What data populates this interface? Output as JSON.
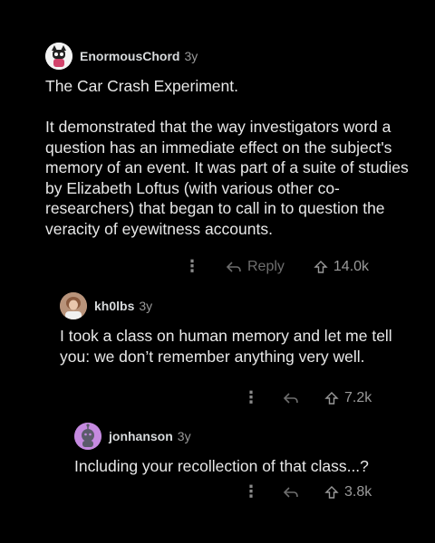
{
  "comments": [
    {
      "username": "EnormousChord",
      "age": "3y",
      "avatar_icon": "cat-avatar-icon",
      "avatar_color": "#ffffff",
      "text": "The Car Crash Experiment.\n\nIt demonstrated that the way investigators word a question has an immediate effect on the subject's memory of an event. It was part of a suite of studies by Elizabeth Loftus (with various other co-researchers) that began to call in to question the veracity of eyewitness accounts.",
      "reply_label": "Reply",
      "score": "14.0k"
    },
    {
      "username": "kh0lbs",
      "age": "3y",
      "avatar_icon": "photo-avatar-icon",
      "avatar_color": "#c9a58a",
      "text": "I took a class on human memory and let me tell you: we don’t remember anything very well.",
      "score": "7.2k"
    },
    {
      "username": "jonhanson",
      "age": "3y",
      "avatar_icon": "alien-avatar-icon",
      "avatar_color": "#c58ae0",
      "text": "Including your recollection of that class...?",
      "score": "3.8k"
    }
  ],
  "icons": {
    "more": "⋮",
    "reply": "reply-arrow-icon",
    "upvote": "upvote-arrow-icon"
  }
}
